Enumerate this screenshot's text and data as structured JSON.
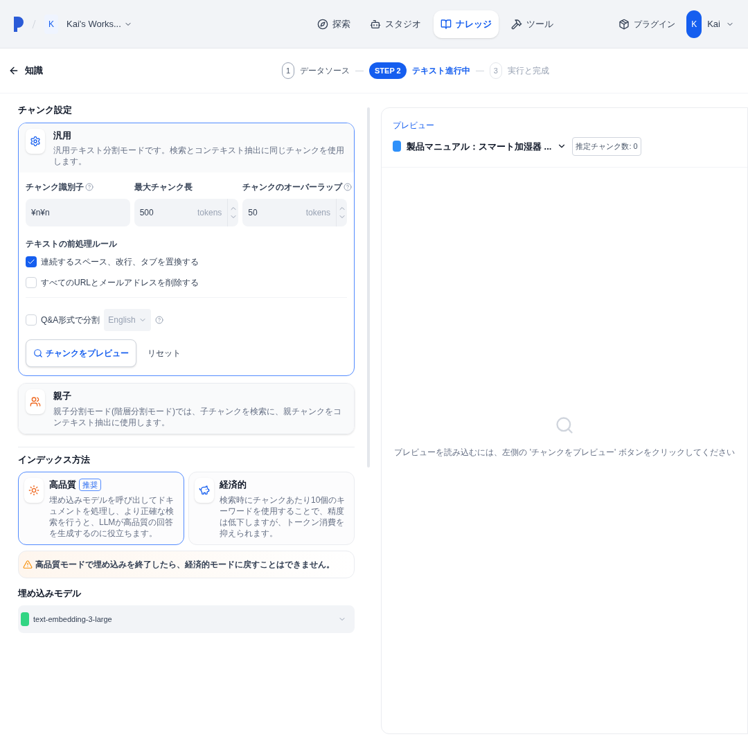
{
  "topbar": {
    "workspace_initial": "K",
    "workspace": "Kai's Works...",
    "nav": [
      {
        "label": "探索",
        "kind": "explore",
        "selected": false
      },
      {
        "label": "スタジオ",
        "kind": "studio",
        "selected": false
      },
      {
        "label": "ナレッジ",
        "kind": "knowledge",
        "selected": true
      },
      {
        "label": "ツール",
        "kind": "tools",
        "selected": false
      }
    ],
    "plugins": "プラグイン",
    "user_initial": "K",
    "user": "Kai"
  },
  "back": "知識",
  "steps": [
    {
      "marker": "1",
      "label": "データソース",
      "selected": false
    },
    {
      "marker": "STEP 2",
      "label": "テキスト進行中",
      "selected": true
    },
    {
      "marker": "3",
      "label": "実行と完成",
      "selected": false
    }
  ],
  "chunk_settings": {
    "title": "チャンク設定",
    "modes": [
      {
        "kind": "general",
        "title": "汎用",
        "description": "汎用テキスト分割モードです。検索とコンテキスト抽出に同じチャンクを使用します。",
        "selected": true
      },
      {
        "kind": "parent",
        "title": "親子",
        "description": "親子分割モード(階層分割モード)では、子チャンクを検索に、親チャンクをコンテキスト抽出に使用します。",
        "selected": false
      }
    ],
    "fields": [
      {
        "label": "チャンク識別子",
        "help": true,
        "value": "¥n¥n",
        "kind": "text"
      },
      {
        "label": "最大チャンク長",
        "help": false,
        "value": "500",
        "unit": "tokens",
        "kind": "number"
      },
      {
        "label": "チャンクのオーバーラップ",
        "help": true,
        "value": "50",
        "unit": "tokens",
        "kind": "number"
      }
    ],
    "rules_title": "テキストの前処理ルール",
    "rules": [
      {
        "label": "連続するスペース、改行、タブを置換する",
        "checked": true
      },
      {
        "label": "すべてのURLとメールアドレスを削除する",
        "checked": false
      }
    ],
    "qa": {
      "label": "Q&A形式で分割",
      "checked": false,
      "language": "English"
    },
    "preview_button": "チャンクをプレビュー",
    "reset_button": "リセット"
  },
  "index_method": {
    "title": "インデックス方法",
    "options": [
      {
        "kind": "quality",
        "title": "高品質",
        "badge": "推奨",
        "description": "埋め込みモデルを呼び出してドキュメントを処理し、より正確な検索を行うと、LLMが高品質の回答を生成するのに役立ちます。",
        "selected": true
      },
      {
        "kind": "economy",
        "title": "経済的",
        "description": "検索時にチャンクあたり10個のキーワードを使用することで、精度は低下しますが、トークン消費を抑えられます。",
        "selected": false
      }
    ],
    "warning": "高品質モードで埋め込みを終了したら、経済的モードに戻すことはできません。"
  },
  "embedding": {
    "title": "埋め込みモデル",
    "model": "text-embedding-3-large"
  },
  "preview": {
    "label": "プレビュー",
    "document": "製品マニュアル：スマート加湿器 ...",
    "estimate": "推定チャンク数: 0",
    "empty_message": "プレビューを読み込むには、左側の 'チャンクをプレビュー' ボタンをクリックしてください"
  }
}
